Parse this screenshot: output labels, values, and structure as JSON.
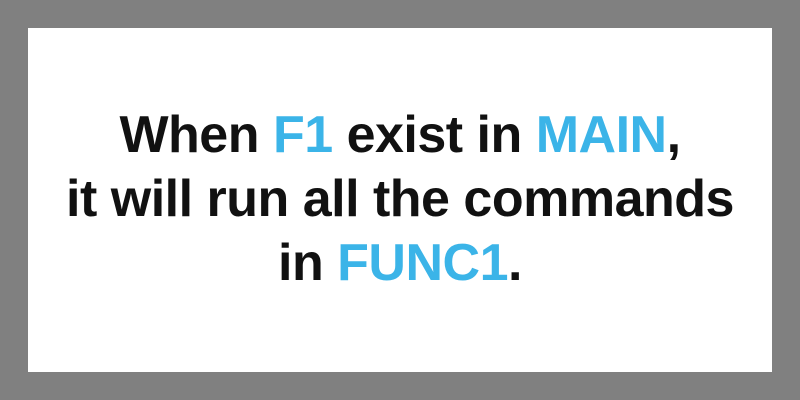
{
  "colors": {
    "frame_background": "#808080",
    "card_background": "#ffffff",
    "text": "#111111",
    "highlight": "#3bb4e8"
  },
  "message": {
    "line1": {
      "part1": "When ",
      "highlight1": "F1",
      "part2": " exist in ",
      "highlight2": "MAIN",
      "part3": ","
    },
    "line2": {
      "text": "it will run all the commands"
    },
    "line3": {
      "part1": "in ",
      "highlight1": "FUNC1",
      "part2": "."
    }
  }
}
